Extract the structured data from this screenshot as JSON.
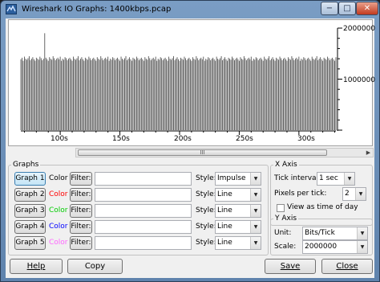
{
  "window": {
    "title": "Wireshark IO Graphs: 1400kbps.pcap",
    "minimize_glyph": "−",
    "maximize_glyph": "□",
    "close_glyph": "✕"
  },
  "graph": {
    "x_ticks": [
      "100s",
      "150s",
      "200s",
      "250s",
      "300s"
    ],
    "y_ticks": [
      "2000000",
      "1000000"
    ]
  },
  "scrollbar": {
    "thumb_glyph": "III",
    "left_glyph": "◀",
    "right_glyph": "▶"
  },
  "graphs_panel": {
    "legend": "Graphs",
    "color_label": "Color",
    "filter_label": "Filter:",
    "style_label": "Style:",
    "rows": [
      {
        "button": "Graph 1",
        "color": "#000000",
        "filter": "",
        "style": "Impulse"
      },
      {
        "button": "Graph 2",
        "color": "#ff0000",
        "filter": "",
        "style": "Line"
      },
      {
        "button": "Graph 3",
        "color": "#00cc00",
        "filter": "",
        "style": "Line"
      },
      {
        "button": "Graph 4",
        "color": "#0000ff",
        "filter": "",
        "style": "Line"
      },
      {
        "button": "Graph 5",
        "color": "#ff66ff",
        "filter": "",
        "style": "Line"
      }
    ]
  },
  "x_axis": {
    "legend": "X Axis",
    "tick_interval_label": "Tick interval:",
    "tick_interval_value": "1 sec",
    "pixels_per_tick_label": "Pixels per tick:",
    "pixels_per_tick_value": "2",
    "view_time_label": "View as time of day",
    "view_time_checked": false
  },
  "y_axis": {
    "legend": "Y Axis",
    "unit_label": "Unit:",
    "unit_value": "Bits/Tick",
    "scale_label": "Scale:",
    "scale_value": "2000000"
  },
  "buttons": {
    "help": "Help",
    "copy": "Copy",
    "save": "Save",
    "close": "Close"
  },
  "chart_data": {
    "type": "bar",
    "x_start": 67,
    "x_step": 1,
    "xlim": [
      67,
      331
    ],
    "ylim": [
      0,
      2000000
    ],
    "series": [
      {
        "name": "Graph 1",
        "color": "#000000",
        "values": [
          1390000,
          1420000,
          1360000,
          1440000,
          1400000,
          1380000,
          1410000,
          1450000,
          1370000,
          1400000,
          1430000,
          1390000,
          1360000,
          1420000,
          1400000,
          1380000,
          1440000,
          1410000,
          1370000,
          1400000,
          1900000,
          1420000,
          1390000,
          1360000,
          1430000,
          1400000,
          1380000,
          1450000,
          1410000,
          1370000,
          1400000,
          1420000,
          1390000,
          1440000,
          1360000,
          1400000,
          1380000,
          1430000,
          1410000,
          1370000,
          1400000,
          1420000,
          1390000,
          1360000,
          1440000,
          1400000,
          1380000,
          1410000,
          1450000,
          1370000,
          1400000,
          1430000,
          1390000,
          1360000,
          1420000,
          1400000,
          1380000,
          1440000,
          1410000,
          1370000,
          1400000,
          1420000,
          1390000,
          1360000,
          1430000,
          1400000,
          1380000,
          1450000,
          1410000,
          1370000,
          1400000,
          1420000,
          1390000,
          1440000,
          1360000,
          1400000,
          1380000,
          1430000,
          1410000,
          1370000,
          1400000,
          1420000,
          1390000,
          1360000,
          1440000,
          1400000,
          1380000,
          1410000,
          1450000,
          1370000,
          1400000,
          1430000,
          1390000,
          1360000,
          1420000,
          1400000,
          1380000,
          1440000,
          1410000,
          1370000,
          1400000,
          1420000,
          1390000,
          1360000,
          1430000,
          1400000,
          1380000,
          1450000,
          1410000,
          1370000,
          1400000,
          1420000,
          1390000,
          1440000,
          1360000,
          1400000,
          1380000,
          1430000,
          1410000,
          1370000,
          1400000,
          1420000,
          1390000,
          1360000,
          1440000,
          1400000,
          1380000,
          1410000,
          1450000,
          1370000,
          1400000,
          1430000,
          1390000,
          1360000,
          1420000,
          1400000,
          1380000,
          1440000,
          1410000,
          1370000,
          1400000,
          1420000,
          1390000,
          1360000,
          1430000,
          1400000,
          1380000,
          1450000,
          1410000,
          1370000,
          1400000,
          1420000,
          1390000,
          1440000,
          1360000,
          1400000,
          1380000,
          1430000,
          1410000,
          1370000,
          1400000,
          1420000,
          1390000,
          1360000,
          1440000,
          1400000,
          1380000,
          1410000,
          1450000,
          1370000,
          1400000,
          1430000,
          1390000,
          1360000,
          1420000,
          1400000,
          1380000,
          1440000,
          1410000,
          1370000,
          1400000,
          1420000,
          1390000,
          1360000,
          1430000,
          1400000,
          1380000,
          1450000,
          1410000,
          1370000,
          1400000,
          1420000,
          1390000,
          1440000,
          1360000,
          1400000,
          1380000,
          1430000,
          1410000,
          1370000,
          1400000,
          1420000,
          1390000,
          1360000,
          1440000,
          1400000,
          1380000,
          1410000,
          1450000,
          1370000,
          1400000,
          1430000,
          1390000,
          1360000,
          1420000,
          1400000,
          1380000,
          1440000,
          1410000,
          1370000,
          1400000,
          1420000,
          1390000,
          1360000,
          1430000,
          1400000,
          1380000,
          1450000,
          1410000,
          1370000,
          1400000,
          1420000,
          1390000,
          1440000,
          1360000,
          1400000,
          1380000,
          1430000,
          1410000,
          1370000,
          1400000,
          1420000,
          1390000,
          1360000,
          1440000,
          1400000,
          1380000,
          1410000,
          1450000,
          1370000,
          1400000,
          1430000,
          1390000,
          1360000,
          1420000,
          1400000,
          1380000,
          1440000,
          1410000,
          1370000,
          1400000,
          1420000,
          1390000,
          1360000,
          1430000
        ]
      }
    ]
  }
}
